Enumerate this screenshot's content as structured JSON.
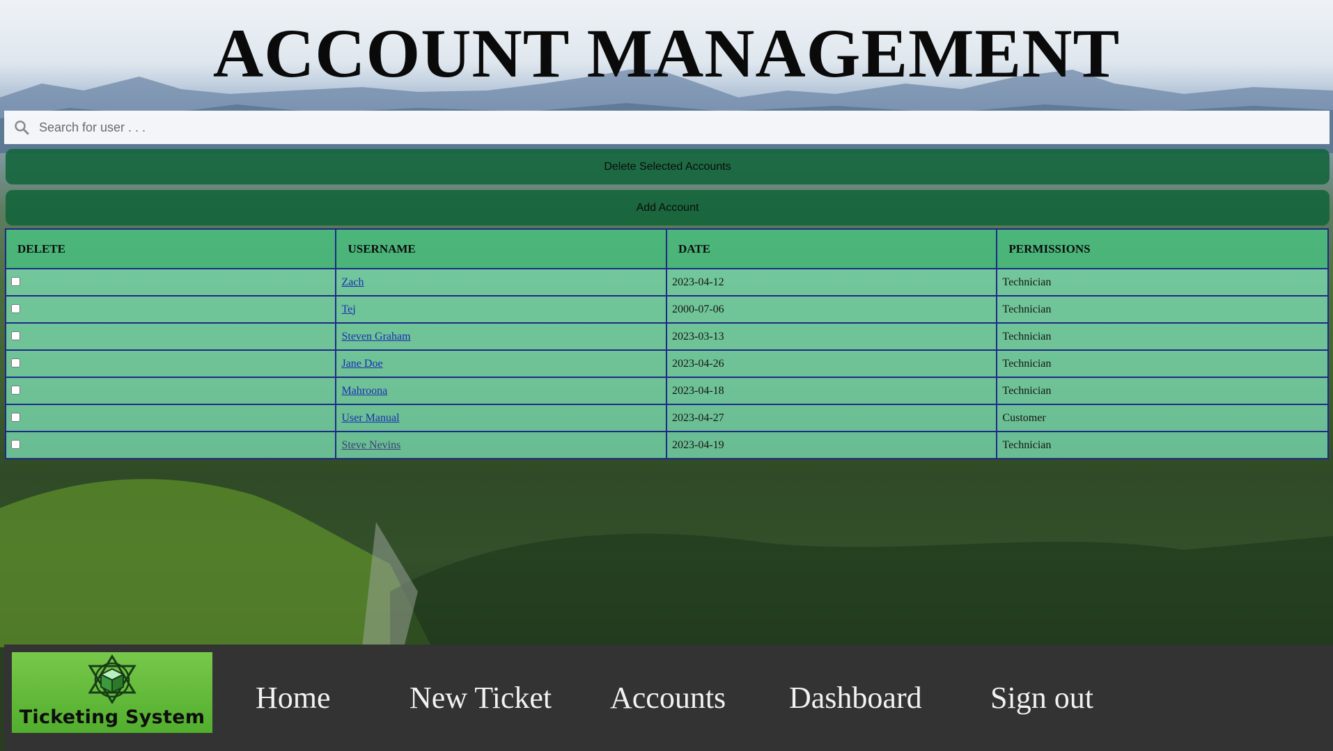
{
  "page": {
    "title": "ACCOUNT MANAGEMENT"
  },
  "search": {
    "placeholder": "Search for user . . .",
    "icon": "search-icon"
  },
  "actions": {
    "delete_label": "Delete Selected Accounts",
    "add_label": "Add Account"
  },
  "table": {
    "headers": [
      "DELETE",
      "USERNAME",
      "DATE",
      "PERMISSIONS"
    ],
    "rows": [
      {
        "checked": false,
        "username": "Zach",
        "date": "2023-04-12",
        "permissions": "Technician"
      },
      {
        "checked": false,
        "username": "Tej",
        "date": "2000-07-06",
        "permissions": "Technician"
      },
      {
        "checked": false,
        "username": "Steven Graham",
        "date": "2023-03-13",
        "permissions": "Technician"
      },
      {
        "checked": false,
        "username": "Jane Doe",
        "date": "2023-04-26",
        "permissions": "Technician"
      },
      {
        "checked": false,
        "username": "Mahroona",
        "date": "2023-04-18",
        "permissions": "Technician"
      },
      {
        "checked": false,
        "username": "User Manual",
        "date": "2023-04-27",
        "permissions": "Customer"
      },
      {
        "checked": false,
        "username": "Steve Nevins",
        "date": "2023-04-19",
        "permissions": "Technician"
      }
    ]
  },
  "footer": {
    "logo_text": "Ticketing System",
    "nav": [
      "Home",
      "New Ticket",
      "Accounts",
      "Dashboard",
      "Sign out"
    ]
  },
  "colors": {
    "button_bg": "#11643a",
    "header_bg": "#4abe80",
    "row_bg": "#80e8bc",
    "table_border": "#1d2a86",
    "footer_bg": "#333333",
    "logo_bg": "#5fb83a"
  }
}
